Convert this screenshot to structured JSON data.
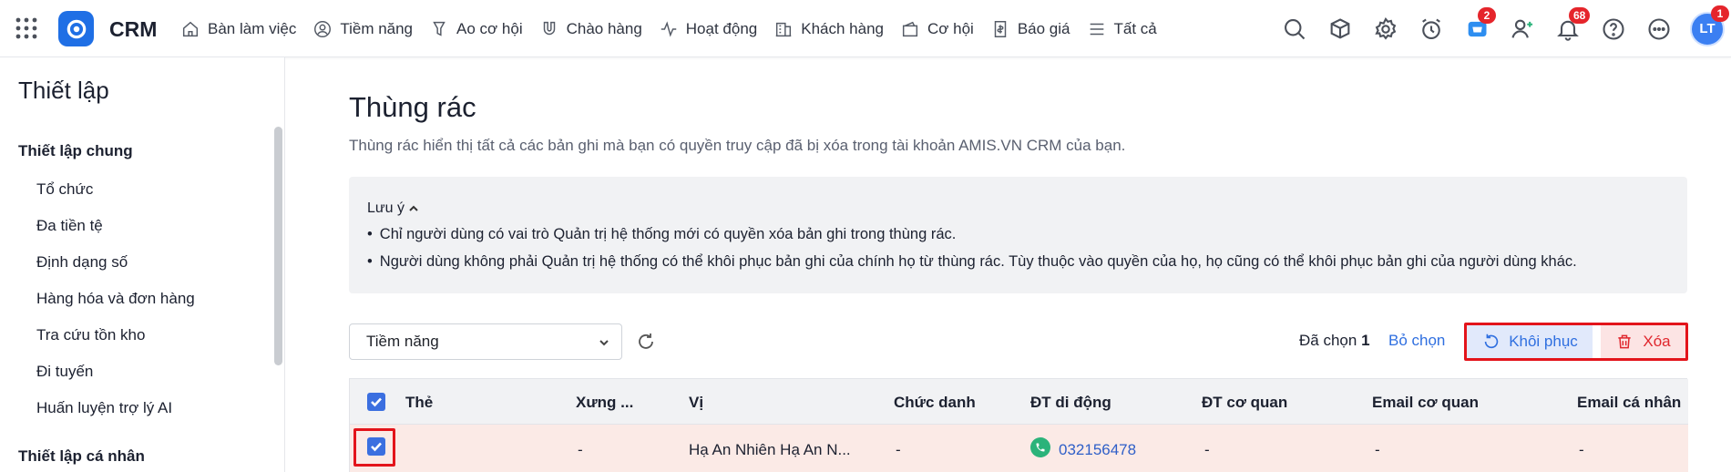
{
  "app": {
    "name": "CRM",
    "accent": "#1f6fe5"
  },
  "nav": {
    "items": [
      {
        "label": "Bàn làm việc",
        "icon": "home-icon"
      },
      {
        "label": "Tiềm năng",
        "icon": "user-circle-icon"
      },
      {
        "label": "Ao cơ hội",
        "icon": "funnel-icon"
      },
      {
        "label": "Chào hàng",
        "icon": "magnet-icon"
      },
      {
        "label": "Hoạt động",
        "icon": "activity-icon"
      },
      {
        "label": "Khách hàng",
        "icon": "building-icon"
      },
      {
        "label": "Cơ hội",
        "icon": "wallet-icon"
      },
      {
        "label": "Báo giá",
        "icon": "invoice-icon"
      },
      {
        "label": "Tất cả",
        "icon": "menu-icon"
      }
    ]
  },
  "topright": {
    "cart_badge": "2",
    "notification_badge": "68",
    "avatar_text": "LT",
    "avatar_badge": "1"
  },
  "sidebar": {
    "title": "Thiết lập",
    "group_general": "Thiết lập chung",
    "items": [
      "Tổ chức",
      "Đa tiền tệ",
      "Định dạng số",
      "Hàng hóa và đơn hàng",
      "Tra cứu tồn kho",
      "Đi tuyến",
      "Huấn luyện trợ lý AI"
    ],
    "group_personal": "Thiết lập cá nhân"
  },
  "main": {
    "title": "Thùng rác",
    "description": "Thùng rác hiển thị tất cả các bản ghi mà bạn có quyền truy cập đã bị xóa trong tài khoản AMIS.VN CRM của bạn.",
    "note": {
      "heading": "Lưu ý",
      "lines": [
        "Chỉ người dùng có vai trò Quản trị hệ thống mới có quyền xóa bản ghi trong thùng rác.",
        "Người dùng không phải Quản trị hệ thống có thể khôi phục bản ghi của chính họ từ thùng rác. Tùy thuộc vào quyền của họ, họ cũng có thể khôi phục bản ghi của người dùng khác."
      ]
    },
    "filter_value": "Tiềm năng",
    "selected_label": "Đã chọn",
    "selected_count": "1",
    "deselect_label": "Bỏ chọn",
    "restore_label": "Khôi phục",
    "delete_label": "Xóa"
  },
  "table": {
    "columns": [
      "Thẻ",
      "Xưng ...",
      "Vị",
      "Chức danh",
      "ĐT di động",
      "ĐT cơ quan",
      "Email cơ quan",
      "Email cá nhân"
    ],
    "rows": [
      {
        "the": "",
        "xung": "-",
        "vi": "Hạ An Nhiên Hạ An N...",
        "chuc_danh": "-",
        "dt_di_dong": "032156478",
        "dt_co_quan": "-",
        "email_co_quan": "-",
        "email_ca_nhan": "-"
      }
    ]
  },
  "colors": {
    "highlight_red": "#e3141b",
    "link_blue": "#2f6fe0",
    "row_selected": "#fbeae6"
  }
}
